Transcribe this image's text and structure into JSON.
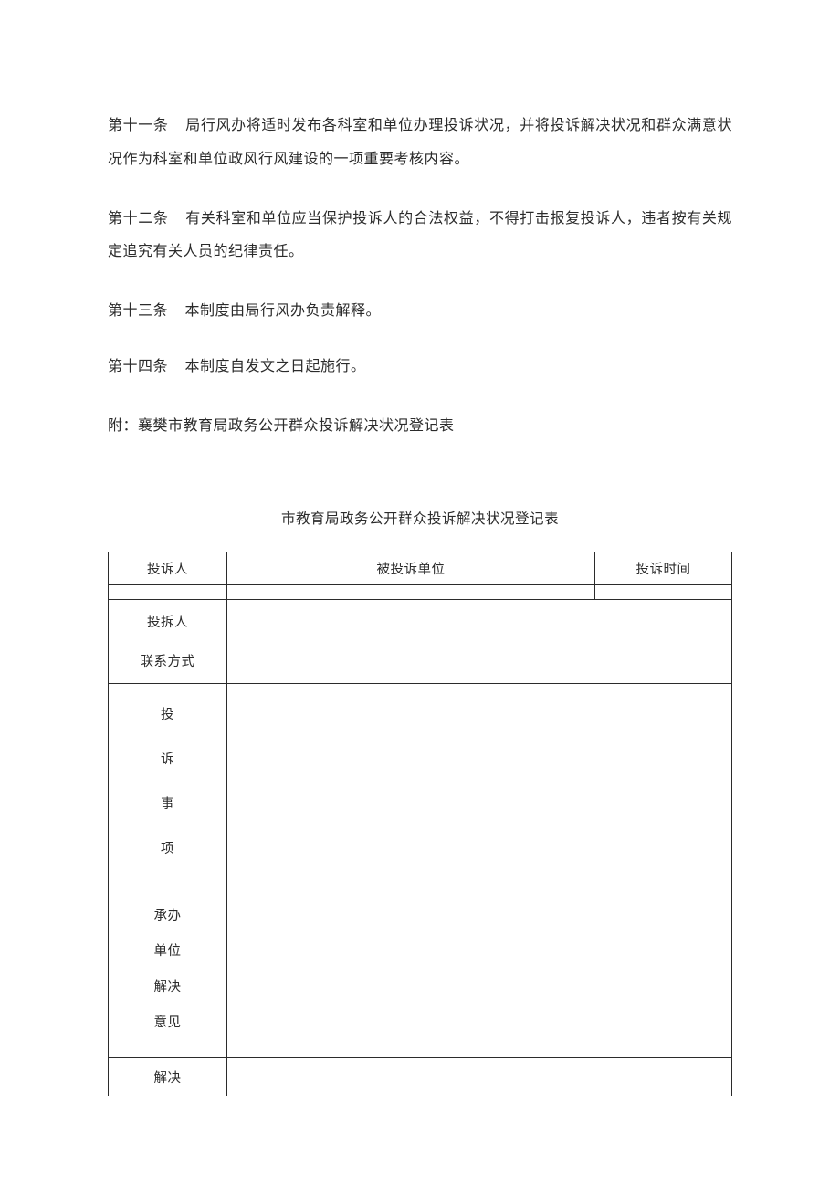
{
  "articles": {
    "a11": {
      "label": "第十一条",
      "text": "局行风办将适时发布各科室和单位办理投诉状况，并将投诉解决状况和群众满意状况作为科室和单位政风行风建设的一项重要考核内容。"
    },
    "a12": {
      "label": "第十二条",
      "text": "有关科室和单位应当保护投诉人的合法权益，不得打击报复投诉人，违者按有关规定追究有关人员的纪律责任。"
    },
    "a13": {
      "label": "第十三条",
      "text": "本制度由局行风办负责解释。"
    },
    "a14": {
      "label": "第十四条",
      "text": "本制度自发文之日起施行。"
    }
  },
  "attachment": {
    "label": "附：",
    "text": "襄樊市教育局政务公开群众投诉解决状况登记表"
  },
  "table_title": "市教育局政务公开群众投诉解决状况登记表",
  "form": {
    "complainant": "投诉人",
    "respondent_unit": "被投诉单位",
    "complaint_time": "投诉时间",
    "complainant2_line1": "投拆人",
    "complainant2_line2": "联系方式",
    "matters_c1": "投",
    "matters_c2": "诉",
    "matters_c3": "事",
    "matters_c4": "项",
    "handling_unit_l1": "承办",
    "handling_unit_l2": "单位",
    "handling_unit_l3": "解决",
    "handling_unit_l4": "意见",
    "result_l1": "解决"
  }
}
